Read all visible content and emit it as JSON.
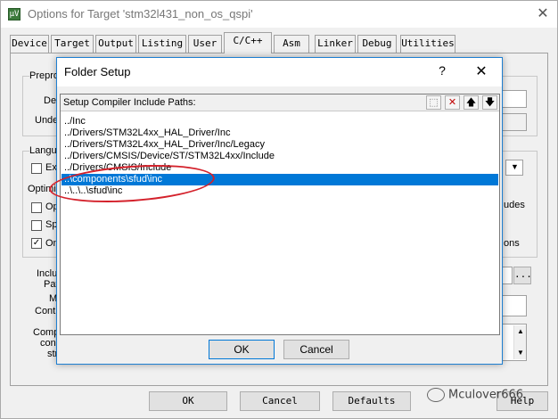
{
  "outer": {
    "title": "Options for Target 'stm32l431_non_os_qspi'",
    "icon_glyph": "μV",
    "close_glyph": "✕",
    "tabs": [
      "Device",
      "Target",
      "Output",
      "Listing",
      "User",
      "C/C++",
      "Asm",
      "Linker",
      "Debug",
      "Utilities"
    ],
    "active_tab": "C/C++",
    "fragments": {
      "prepro": "Prepro",
      "def": "De",
      "undef": "Unde",
      "lang": "Langu",
      "ex": "Ex",
      "optimi": "Optimi",
      "op": "Op",
      "sp": "Sp",
      "on": "On",
      "udes": "udes",
      "ons": "ons",
      "inclu": "Inclu",
      "pat": "Pat",
      "m": "M",
      "contr": "Contr",
      "comp": "Comp",
      "con": "con",
      "str": "str",
      "ellipsis": "...",
      "help": "Help",
      "on_checked": "✓"
    },
    "buttons": {
      "ok": "OK",
      "cancel": "Cancel",
      "defaults": "Defaults"
    },
    "watermark": "Mculover666"
  },
  "modal": {
    "title": "Folder Setup",
    "help_glyph": "?",
    "close_glyph": "✕",
    "list_header": "Setup Compiler Include Paths:",
    "toolbar": {
      "new_glyph": "⬚",
      "delete_glyph": "✕",
      "up_glyph": "🡅",
      "down_glyph": "🡇"
    },
    "paths": [
      "../Inc",
      "../Drivers/STM32L4xx_HAL_Driver/Inc",
      "../Drivers/STM32L4xx_HAL_Driver/Inc/Legacy",
      "../Drivers/CMSIS/Device/ST/STM32L4xx/Include",
      "../Drivers/CMSIS/Include",
      "..\\components\\sfud\\inc",
      "..\\..\\..\\sfud\\inc"
    ],
    "selected_index": 5,
    "ok_label": "OK",
    "cancel_label": "Cancel"
  },
  "colors": {
    "selection": "#0078d7",
    "annotation": "#d4212b",
    "modal_border": "#1e7fd1"
  }
}
